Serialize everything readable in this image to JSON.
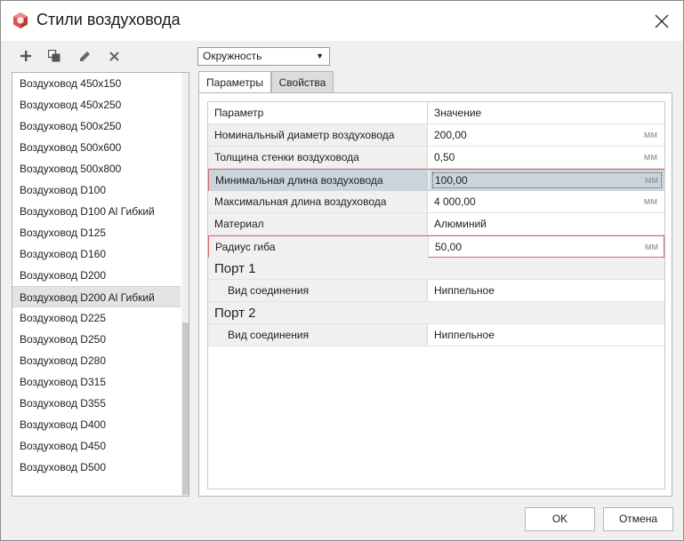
{
  "window": {
    "title": "Стили воздуховода"
  },
  "toolbar": {
    "add_icon": "plus-icon",
    "copy_icon": "duplicate-icon",
    "edit_icon": "pencil-icon",
    "delete_icon": "x-icon"
  },
  "styles_list": [
    {
      "label": "Воздуховод 450x150"
    },
    {
      "label": "Воздуховод 450x250"
    },
    {
      "label": "Воздуховод 500x250"
    },
    {
      "label": "Воздуховод 500x600"
    },
    {
      "label": "Воздуховод 500x800"
    },
    {
      "label": "Воздуховод D100"
    },
    {
      "label": "Воздуховод D100 Al Гибкий"
    },
    {
      "label": "Воздуховод D125"
    },
    {
      "label": "Воздуховод D160"
    },
    {
      "label": "Воздуховод D200"
    },
    {
      "label": "Воздуховод D200 Al Гибкий",
      "selected": true
    },
    {
      "label": "Воздуховод D225"
    },
    {
      "label": "Воздуховод D250"
    },
    {
      "label": "Воздуховод D280"
    },
    {
      "label": "Воздуховод D315"
    },
    {
      "label": "Воздуховод D355"
    },
    {
      "label": "Воздуховод D400"
    },
    {
      "label": "Воздуховод D450"
    },
    {
      "label": "Воздуховод D500"
    }
  ],
  "shape_dropdown": {
    "value": "Окружность"
  },
  "tabs": [
    {
      "label": "Параметры",
      "active": true
    },
    {
      "label": "Свойства",
      "active": false
    }
  ],
  "grid": {
    "header": {
      "name": "Параметр",
      "value": "Значение"
    },
    "rows": [
      {
        "name": "Номинальный диаметр воздуховода",
        "value": "200,00",
        "unit": "мм"
      },
      {
        "name": "Толщина стенки воздуховода",
        "value": "0,50",
        "unit": "мм"
      },
      {
        "name": "Минимальная длина воздуховода",
        "value": "100,00",
        "unit": "мм"
      },
      {
        "name": "Максимальная длина воздуховода",
        "value": "4 000,00",
        "unit": "мм"
      },
      {
        "name": "Материал",
        "value": "Алюминий"
      },
      {
        "name": "Радиус гиба",
        "value": "50,00",
        "unit": "мм"
      }
    ],
    "sections": [
      {
        "title": "Порт 1",
        "rows": [
          {
            "name": "Вид соединения",
            "value": "Ниппельное"
          }
        ]
      },
      {
        "title": "Порт 2",
        "rows": [
          {
            "name": "Вид соединения",
            "value": "Ниппельное"
          }
        ]
      }
    ]
  },
  "buttons": {
    "ok": "OK",
    "cancel": "Отмена"
  },
  "colors": {
    "highlight_border": "#e0636b",
    "selected_row": "#ccd4db",
    "app_icon": "#d9534f"
  }
}
